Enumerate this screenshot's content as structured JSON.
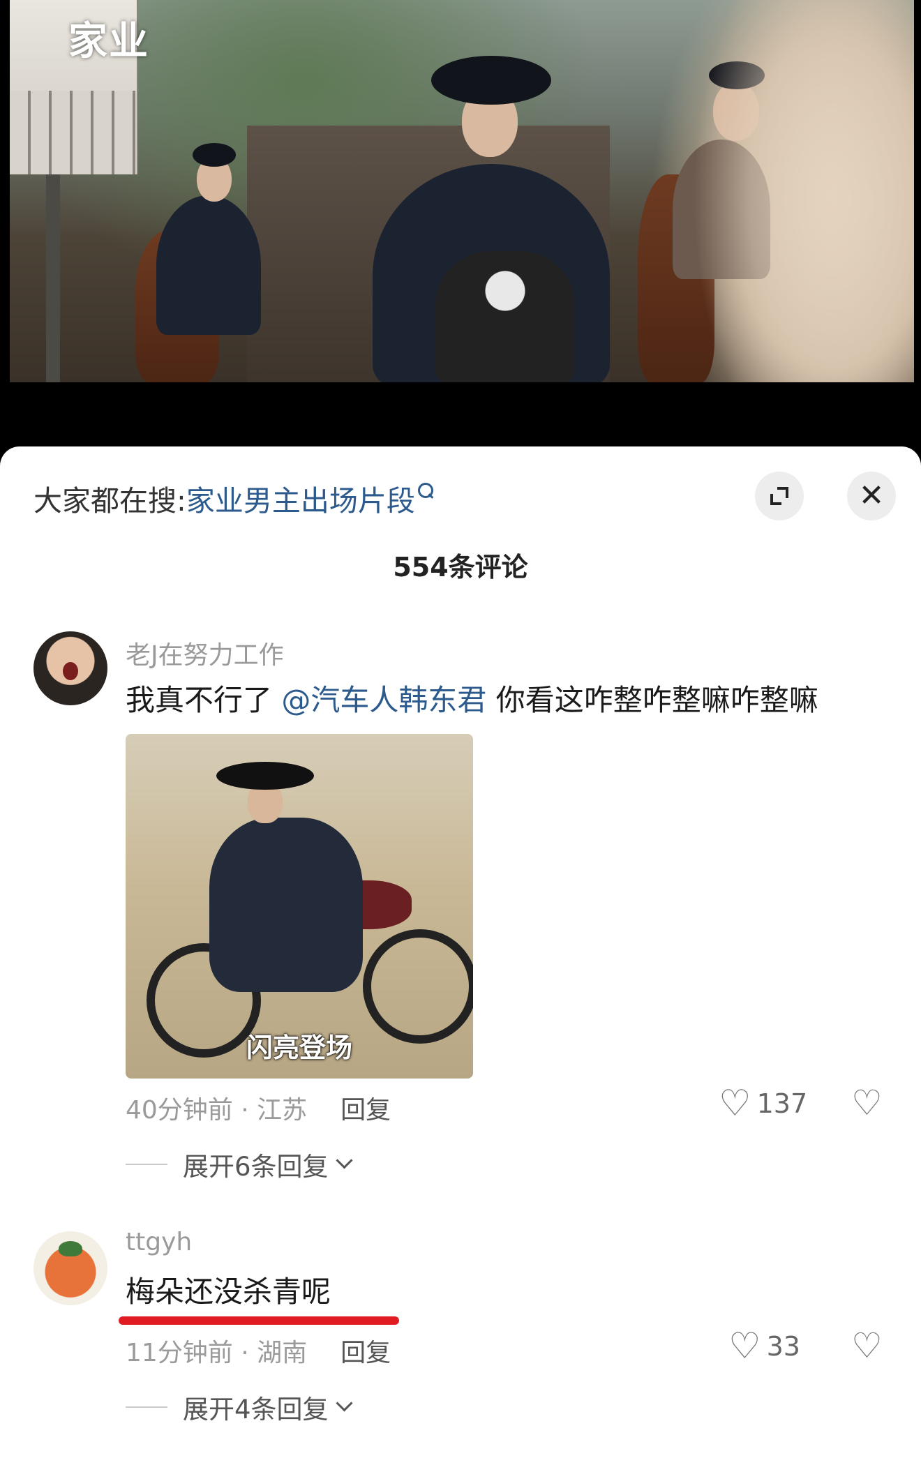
{
  "video": {
    "title_overlay": "家业"
  },
  "search": {
    "prefix": "大家都在搜:",
    "query": "家业男主出场片段"
  },
  "comment_count": "554条评论",
  "comments": [
    {
      "username": "老J在努力工作",
      "text_before": "我真不行了 ",
      "mention": "@汽车人韩东君",
      "text_after": " 你看这咋整咋整嘛咋整嘛",
      "image_caption": "闪亮登场",
      "time_location": "40分钟前 · 江苏",
      "reply_label": "回复",
      "likes": "137",
      "expand_replies": "展开6条回复"
    },
    {
      "username": "ttgyh",
      "text": "梅朵还没杀青呢",
      "time_location": "11分钟前 · 湖南",
      "reply_label": "回复",
      "likes": "33",
      "expand_replies": "展开4条回复"
    }
  ],
  "icons": {
    "expand": "expand-icon",
    "close": "close-icon",
    "like": "heart-icon",
    "dislike": "broken-heart-icon",
    "search": "search-icon"
  },
  "colors": {
    "link": "#2c5a8c",
    "underline": "#e01b22"
  }
}
